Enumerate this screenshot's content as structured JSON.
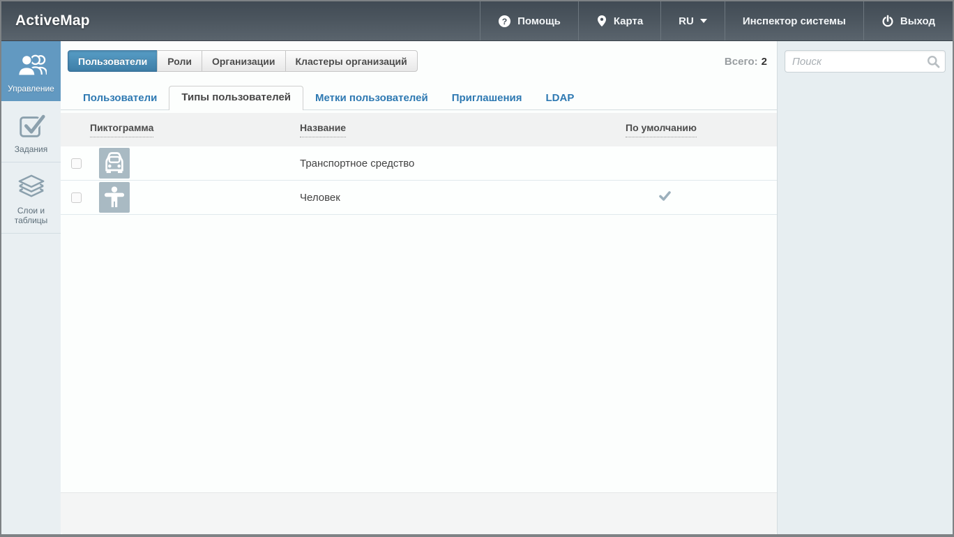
{
  "header": {
    "logo": "ActiveMap",
    "nav": [
      {
        "label": "Помощь",
        "icon": "question-circle-icon"
      },
      {
        "label": "Карта",
        "icon": "map-pin-icon"
      },
      {
        "label": "RU",
        "icon": "caret-down-icon"
      },
      {
        "label": "Инспектор системы",
        "icon": ""
      },
      {
        "label": "Выход",
        "icon": "power-icon"
      }
    ]
  },
  "sidebar": {
    "items": [
      {
        "label": "Управление",
        "icon": "users-group-icon",
        "active": true
      },
      {
        "label": "Задания",
        "icon": "check-square-icon",
        "active": false
      },
      {
        "label": "Слои и таблицы",
        "icon": "layers-icon",
        "active": false
      }
    ]
  },
  "main": {
    "primary_tabs": [
      {
        "label": "Пользователи",
        "active": true
      },
      {
        "label": "Роли",
        "active": false
      },
      {
        "label": "Организации",
        "active": false
      },
      {
        "label": "Кластеры организаций",
        "active": false
      }
    ],
    "total_label": "Всего:",
    "total_value": "2",
    "secondary_tabs": [
      {
        "label": "Пользователи",
        "active": false
      },
      {
        "label": "Типы пользователей",
        "active": true
      },
      {
        "label": "Метки пользователей",
        "active": false
      },
      {
        "label": "Приглашения",
        "active": false
      },
      {
        "label": "LDAP",
        "active": false
      }
    ],
    "table": {
      "columns": [
        "Пиктограмма",
        "Название",
        "По умолчанию"
      ],
      "rows": [
        {
          "icon": "vehicle-icon",
          "name": "Транспортное средство",
          "is_default": false
        },
        {
          "icon": "person-icon",
          "name": "Человек",
          "is_default": true
        }
      ]
    }
  },
  "search": {
    "placeholder": "Поиск"
  },
  "colors": {
    "accent_blue": "#6299c1",
    "header_dark": "#4a545d",
    "tile_gray_blue": "#a9bac3",
    "link_blue": "#2e79b2",
    "default_check": "#9cb0bc"
  }
}
